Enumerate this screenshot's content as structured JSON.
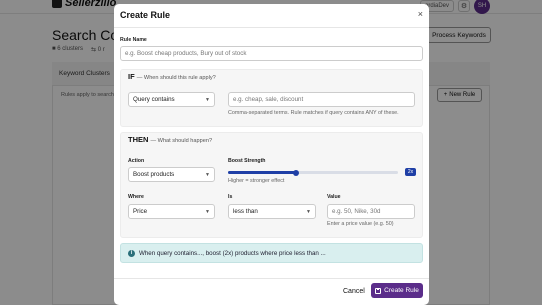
{
  "app": {
    "logo": "Sellerzillo",
    "org": "ardiaDev",
    "avatar": "SH",
    "page_title": "Search Con",
    "meta_clusters": "6 clusters",
    "meta_other": "0 r",
    "process_button": "Process Keywords",
    "panel_tab": "Keyword Clusters",
    "panel_note": "Rules apply to search",
    "new_rule_button": "New Rule"
  },
  "modal": {
    "title": "Create Rule",
    "close": "×",
    "rule_name": {
      "label": "Rule Name",
      "placeholder": "e.g. Boost cheap products, Bury out of stock"
    },
    "if_section": {
      "keyword": "IF",
      "subtitle": "— When should this rule apply?",
      "condition_select": "Query contains",
      "terms_placeholder": "e.g. cheap, sale, discount",
      "help": "Comma-separated terms. Rule matches if query contains ANY of these."
    },
    "then_section": {
      "keyword": "THEN",
      "subtitle": "— What should happen?",
      "action_label": "Action",
      "action_select": "Boost products",
      "strength_label": "Boost Strength",
      "strength_value": 2,
      "strength_max": 5,
      "strength_badge": "2x",
      "strength_help": "Higher = stronger effect",
      "where_label": "Where",
      "where_select": "Price",
      "is_label": "Is",
      "is_select": "less than",
      "value_label": "Value",
      "value_placeholder": "e.g. 50, Nike, 30d",
      "value_help": "Enter a price value (e.g. 50)"
    },
    "summary": "When query contains..., boost (2x) products where price less than ...",
    "cancel_button": "Cancel",
    "create_button": "Create Rule"
  },
  "colors": {
    "accent": "#5b2d8a",
    "slider": "#1f3fa6",
    "info_bg": "#d9efef"
  },
  "icons": [
    "logo-icon",
    "gear-icon",
    "cluster-icon",
    "plus-icon",
    "close-icon",
    "chevron-down-icon",
    "info-icon",
    "save-icon"
  ]
}
